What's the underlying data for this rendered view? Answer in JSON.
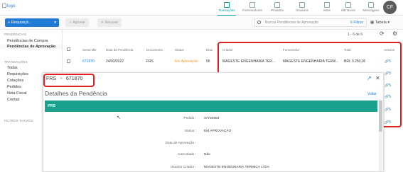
{
  "topbar": {
    "logo_alt": "logo",
    "nav": [
      {
        "label": "Transações",
        "icon": "transactions-icon",
        "active": true
      },
      {
        "label": "Fornecedores",
        "icon": "suppliers-icon",
        "active": false
      },
      {
        "label": "Produtos",
        "icon": "products-icon",
        "active": false
      },
      {
        "label": "Usuários",
        "icon": "users-icon",
        "active": false
      },
      {
        "label": "Mais",
        "icon": "more-icon",
        "active": false
      },
      {
        "label": "ME Boost",
        "icon": "me-boost-icon",
        "active": false
      },
      {
        "label": "Mensagens",
        "icon": "messages-icon",
        "active": false
      }
    ],
    "avatar_initials": "CF"
  },
  "toolbar": {
    "new_requisition": "Requisiçã...",
    "approve": "Aprovar",
    "reject": "Recusar",
    "search_placeholder": "Buscar Pendências de Aprovação",
    "filters": "Filtros",
    "view": "Tabela"
  },
  "sidebar": {
    "pending_section": "PENDÊNCIAS",
    "pending_items": [
      "Pendências de Compra",
      "Pendências de Aprovação"
    ],
    "transactions_section": "TRANSAÇÕES",
    "transaction_items": [
      "Todas",
      "Requisições",
      "Cotações",
      "Pedidos",
      "Nota Fiscal",
      "Contas"
    ],
    "saved_filters_section": "FILTROS SALVOS"
  },
  "list": {
    "count": "1 - 6 de 6",
    "columns": [
      "Serial ME",
      "Data da Pendência",
      "Documento",
      "Status",
      "Dias",
      "Criador",
      "Fornecedor",
      "Total",
      "Anexos"
    ],
    "row": {
      "serial": "671870",
      "date": "24/03/2022",
      "document": "FRS",
      "status": "Em Aprovação",
      "days": "56",
      "creator": "MAGESTE ENGENHARIA TER...",
      "supplier": "MAGESTE ENGENHARIA TERM...",
      "total": "BRL 3.250,00",
      "attachments": "5"
    },
    "attachment_counts": [
      "5",
      "5",
      "5",
      "5",
      "5"
    ]
  },
  "detail": {
    "doc_type": "FRS",
    "separator": ">",
    "doc_id": "671870",
    "title": "Detalhes da Pendência",
    "back": "Voltar",
    "section": "FRS",
    "fields": [
      {
        "label": "Pedido :",
        "value": "37734653"
      },
      {
        "label": "Status :",
        "value": "EM APROVAÇÃO"
      },
      {
        "label": "Data de Aprovação :",
        "value": ""
      },
      {
        "label": "Cancelado :",
        "value": "Não"
      },
      {
        "label": "Usuário Criador :",
        "value": "MAGESTE ENGENHARIA TERMICA LTDA"
      }
    ]
  },
  "colors": {
    "accent": "#1f7bd6",
    "green": "#1aa08f",
    "highlight": "#e02020"
  }
}
